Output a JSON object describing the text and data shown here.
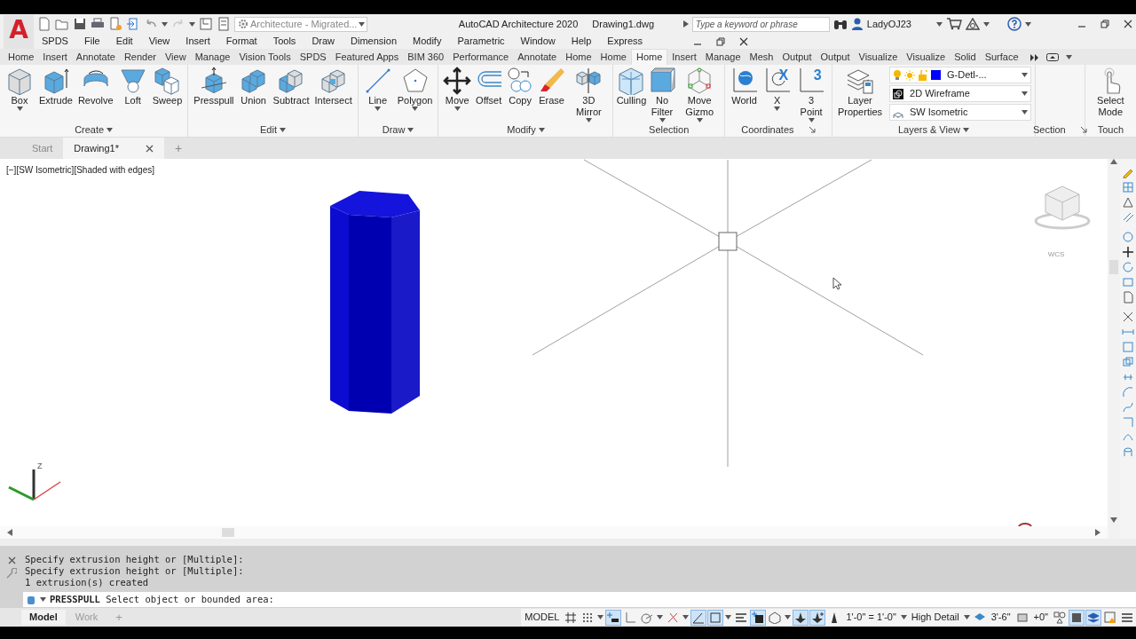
{
  "title_bar": {
    "logo": "A",
    "workspace": "Architecture - Migrated...",
    "app_title": "AutoCAD Architecture 2020",
    "file_name": "Drawing1.dwg",
    "search": {
      "placeholder": "Type a keyword or phrase"
    },
    "user": "LadyOJ23"
  },
  "menu_bar": [
    "SPDS",
    "File",
    "Edit",
    "View",
    "Insert",
    "Format",
    "Tools",
    "Draw",
    "Dimension",
    "Modify",
    "Parametric",
    "Window",
    "Help",
    "Express"
  ],
  "ribbon_tabs": [
    {
      "label": "Home",
      "selected": false
    },
    {
      "label": "Insert",
      "selected": false
    },
    {
      "label": "Annotate",
      "selected": false
    },
    {
      "label": "Render",
      "selected": false
    },
    {
      "label": "View",
      "selected": false
    },
    {
      "label": "Manage",
      "selected": false
    },
    {
      "label": "Vision Tools",
      "selected": false
    },
    {
      "label": "SPDS",
      "selected": false
    },
    {
      "label": "Featured Apps",
      "selected": false
    },
    {
      "label": "BIM 360",
      "selected": false
    },
    {
      "label": "Performance",
      "selected": false
    },
    {
      "label": "Annotate",
      "selected": false
    },
    {
      "label": "Home",
      "selected": false
    },
    {
      "label": "Home",
      "selected": false
    },
    {
      "label": "Home",
      "selected": true
    },
    {
      "label": "Insert",
      "selected": false
    },
    {
      "label": "Manage",
      "selected": false
    },
    {
      "label": "Mesh",
      "selected": false
    },
    {
      "label": "Output",
      "selected": false
    },
    {
      "label": "Output",
      "selected": false
    },
    {
      "label": "Visualize",
      "selected": false
    },
    {
      "label": "Visualize",
      "selected": false
    },
    {
      "label": "Solid",
      "selected": false
    },
    {
      "label": "Surface",
      "selected": false
    }
  ],
  "ribbon_panels": [
    {
      "title": "Create",
      "expandable": true,
      "launcher": false,
      "tools": [
        {
          "label": "Box",
          "has_menu": true
        },
        {
          "label": "Extrude",
          "has_menu": false
        },
        {
          "label": "Revolve",
          "has_menu": false
        },
        {
          "label": "Loft",
          "has_menu": false
        },
        {
          "label": "Sweep",
          "has_menu": false
        }
      ]
    },
    {
      "title": "Edit",
      "expandable": true,
      "launcher": false,
      "tools": [
        {
          "label": "Presspull",
          "has_menu": false
        },
        {
          "label": "Union",
          "has_menu": false
        },
        {
          "label": "Subtract",
          "has_menu": false
        },
        {
          "label": "Intersect",
          "has_menu": false
        }
      ]
    },
    {
      "title": "Draw",
      "expandable": true,
      "launcher": false,
      "tools": [
        {
          "label": "Line",
          "has_menu": true
        },
        {
          "label": "Polygon",
          "has_menu": true
        }
      ]
    },
    {
      "title": "Modify",
      "expandable": true,
      "launcher": false,
      "tools": [
        {
          "label": "Move",
          "has_menu": true
        },
        {
          "label": "Offset",
          "has_menu": false
        },
        {
          "label": "Copy",
          "has_menu": false
        },
        {
          "label": "Erase",
          "has_menu": false
        },
        {
          "label": "3D Mirror",
          "has_menu": true
        }
      ]
    },
    {
      "title": "Selection",
      "expandable": false,
      "launcher": false,
      "tools": [
        {
          "label": "Culling",
          "has_menu": false
        },
        {
          "label": "No Filter",
          "has_menu": true
        },
        {
          "label": "Move Gizmo",
          "has_menu": true
        }
      ]
    },
    {
      "title": "Coordinates",
      "expandable": false,
      "launcher": true,
      "tools": [
        {
          "label": "World",
          "has_menu": false
        },
        {
          "label": "X",
          "has_menu": true,
          "icon_text": "X"
        },
        {
          "label": "3 Point",
          "has_menu": true,
          "icon_text": "3"
        }
      ]
    },
    {
      "title": "Layers & View",
      "expandable": true,
      "launcher": false,
      "tools": [
        {
          "label": "Layer Properties",
          "has_menu": false
        }
      ],
      "dropdowns": [
        "G-Detl-...",
        "2D Wireframe",
        "SW Isometric"
      ]
    },
    {
      "title": "Section",
      "expandable": false,
      "launcher": true
    },
    {
      "title": "Touch",
      "expandable": false,
      "launcher": false,
      "tools": [
        {
          "label": "Select Mode",
          "has_menu": false
        }
      ]
    }
  ],
  "file_tabs": [
    {
      "label": "Start",
      "selected": false,
      "closable": false
    },
    {
      "label": "Drawing1*",
      "selected": true,
      "closable": true
    }
  ],
  "new_tab": "+",
  "viewport": {
    "label": "[−][SW Isometric][Shaded with edges]",
    "wcs": "WCS",
    "axis_label": "Z"
  },
  "command_line": {
    "history": [
      "Specify extrusion height or [Multiple]:",
      "Specify extrusion height or [Multiple]:",
      "1 extrusion(s) created"
    ],
    "prompt": "**PRESSPULL** Select object or bounded area:"
  },
  "layout_tabs": [
    {
      "label": "Model",
      "selected": true
    },
    {
      "label": "Work",
      "selected": false
    }
  ],
  "new_layout": "+",
  "status_bar": [
    {
      "kind": "text",
      "label": "MODEL"
    },
    {
      "kind": "toggle",
      "on": false
    },
    {
      "kind": "toggle",
      "on": false
    },
    {
      "kind": "caret"
    },
    {
      "kind": "toggle",
      "on": true
    },
    {
      "kind": "toggle",
      "on": false
    },
    {
      "kind": "toggle",
      "on": false
    },
    {
      "kind": "caret"
    },
    {
      "kind": "toggle",
      "on": false
    },
    {
      "kind": "caret"
    },
    {
      "kind": "toggle",
      "on": true
    },
    {
      "kind": "toggle",
      "on": true
    },
    {
      "kind": "caret"
    },
    {
      "kind": "toggle",
      "on": false
    },
    {
      "kind": "toggle",
      "on": true
    },
    {
      "kind": "toggle",
      "on": false
    },
    {
      "kind": "caret"
    },
    {
      "kind": "toggle",
      "on": true
    },
    {
      "kind": "toggle",
      "on": true
    },
    {
      "kind": "toggle",
      "on": false
    },
    {
      "kind": "text",
      "label": "1'-0\" = 1'-0\""
    },
    {
      "kind": "caret"
    },
    {
      "kind": "text",
      "label": "High Detail"
    },
    {
      "kind": "caret"
    },
    {
      "kind": "toggle",
      "on": false
    },
    {
      "kind": "text",
      "label": "3'-6\""
    },
    {
      "kind": "toggle",
      "on": false
    },
    {
      "kind": "text",
      "label": "+0\""
    },
    {
      "kind": "toggle",
      "on": false
    },
    {
      "kind": "toggle",
      "on": true
    },
    {
      "kind": "toggle",
      "on": true
    },
    {
      "kind": "toggle",
      "on": false
    },
    {
      "kind": "toggle",
      "on": false
    }
  ]
}
